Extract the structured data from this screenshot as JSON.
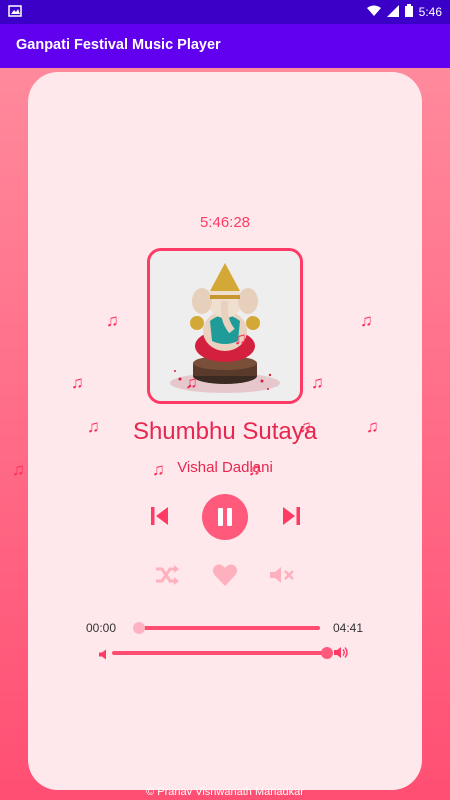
{
  "status": {
    "time": "5:46"
  },
  "appbar": {
    "title": "Ganpati Festival Music Player"
  },
  "player": {
    "clock": "5:46:28",
    "song_title": "Shumbhu Sutaya",
    "artist": "Vishal Dadlani",
    "elapsed": "00:00",
    "duration": "04:41",
    "progress": 0.0,
    "volume": 0.95
  },
  "controls": {
    "previous_icon": "skip-previous-icon",
    "play_pause_icon": "pause-icon",
    "next_icon": "skip-next-icon",
    "shuffle_icon": "shuffle-icon",
    "favorite_icon": "heart-icon",
    "mute_icon": "volume-off-icon"
  },
  "footer": {
    "text": "© Pranav Vishwanath Mahadkar"
  },
  "colors": {
    "accent": "#ff3a64",
    "appbar": "#6100ee",
    "statusbar": "#3a00c8",
    "card": "#ffe8ec"
  }
}
